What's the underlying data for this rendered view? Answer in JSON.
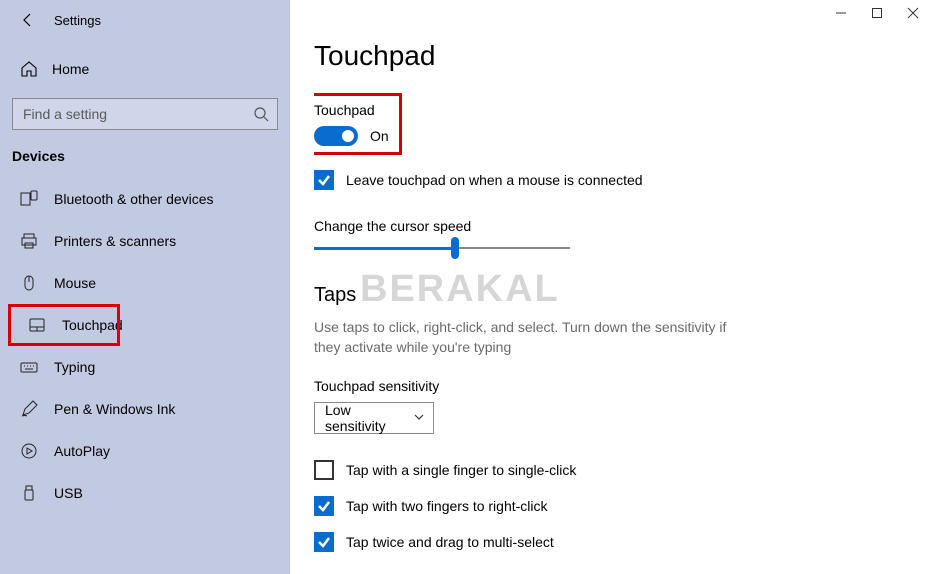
{
  "app": {
    "title": "Settings"
  },
  "sidebar": {
    "home": "Home",
    "search_placeholder": "Find a setting",
    "section": "Devices",
    "items": [
      {
        "label": "Bluetooth & other devices"
      },
      {
        "label": "Printers & scanners"
      },
      {
        "label": "Mouse"
      },
      {
        "label": "Touchpad"
      },
      {
        "label": "Typing"
      },
      {
        "label": "Pen & Windows Ink"
      },
      {
        "label": "AutoPlay"
      },
      {
        "label": "USB"
      }
    ]
  },
  "main": {
    "title": "Touchpad",
    "toggle": {
      "label": "Touchpad",
      "state": "On"
    },
    "leave_on_mouse": "Leave touchpad on when a mouse is connected",
    "cursor_speed_label": "Change the cursor speed",
    "taps_heading": "Taps",
    "taps_desc": "Use taps to click, right-click, and select. Turn down the sensitivity if they activate while you're typing",
    "sensitivity_label": "Touchpad sensitivity",
    "sensitivity_value": "Low sensitivity",
    "tap_single": "Tap with a single finger to single-click",
    "tap_two": "Tap with two fingers to right-click",
    "tap_drag": "Tap twice and drag to multi-select"
  },
  "watermark": "BERAKAL"
}
